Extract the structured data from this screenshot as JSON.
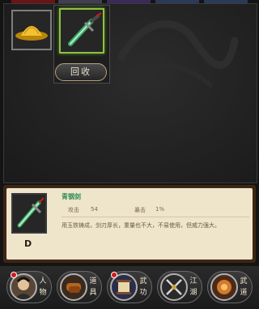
{
  "inventory": {
    "tab_colors": [
      "#6b1414",
      "#4a4a5a",
      "#3a2a5a",
      "#2a3a5a",
      "#2a3a5a"
    ]
  },
  "slots": [
    {
      "item": "golden-straw-hat-icon"
    },
    {
      "item": "jade-sword-icon",
      "selected": true
    }
  ],
  "popup": {
    "recycle_label": "回收"
  },
  "detail": {
    "name": "青钢剑",
    "attack_label": "攻击",
    "attack_value": "54",
    "crit_label": "暴击",
    "crit_value": "1%",
    "grade": "D",
    "description": "用玉铁铸成，剑刃厚长，重量也不大，不易使用，但威力强大。"
  },
  "nav": [
    {
      "top": "人",
      "bottom": "物",
      "icon": "hero-portrait-icon",
      "badge": true
    },
    {
      "top": "道",
      "bottom": "具",
      "icon": "scroll-bundle-icon",
      "badge": false
    },
    {
      "top": "武",
      "bottom": "功",
      "icon": "martial-scroll-icon",
      "badge": true
    },
    {
      "top": "江",
      "bottom": "湖",
      "icon": "crossed-swords-icon",
      "badge": false
    },
    {
      "top": "武",
      "bottom": "道",
      "icon": "martial-path-icon",
      "badge": false
    }
  ],
  "colors": {
    "accent_green": "#8cc23f",
    "parchment": "#efe5cb",
    "gold_border": "#b9a47e"
  }
}
